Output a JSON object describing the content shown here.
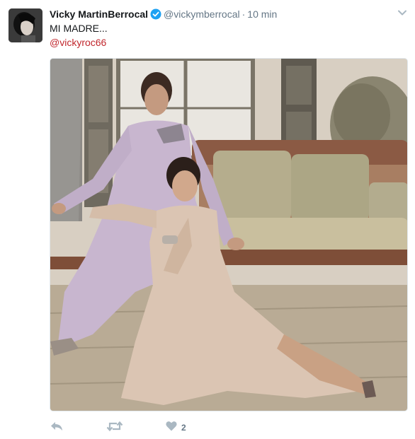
{
  "tweet": {
    "display_name": "Vicky MartinBerrocal",
    "handle": "@vickymberrocal",
    "separator": "·",
    "time": "10 min",
    "text": "MI MADRE...",
    "mention": "@vickyroc66",
    "like_count": "2"
  },
  "icons": {
    "verified": "verified-badge-icon",
    "caret": "chevron-down-icon",
    "reply": "reply-icon",
    "retweet": "retweet-icon",
    "like": "heart-icon"
  },
  "colors": {
    "verified_blue": "#1da1f2",
    "mention_red": "#c1272d",
    "muted": "#657786",
    "action_icon": "#aab8c2"
  }
}
